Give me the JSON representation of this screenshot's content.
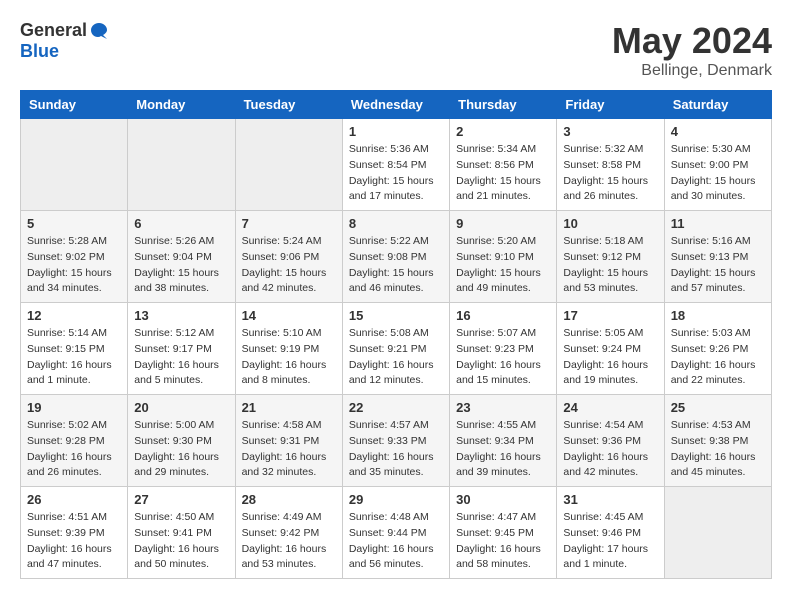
{
  "header": {
    "logo_general": "General",
    "logo_blue": "Blue",
    "title": "May 2024",
    "subtitle": "Bellinge, Denmark"
  },
  "weekdays": [
    "Sunday",
    "Monday",
    "Tuesday",
    "Wednesday",
    "Thursday",
    "Friday",
    "Saturday"
  ],
  "weeks": [
    [
      {
        "day": "",
        "info": ""
      },
      {
        "day": "",
        "info": ""
      },
      {
        "day": "",
        "info": ""
      },
      {
        "day": "1",
        "info": "Sunrise: 5:36 AM\nSunset: 8:54 PM\nDaylight: 15 hours\nand 17 minutes."
      },
      {
        "day": "2",
        "info": "Sunrise: 5:34 AM\nSunset: 8:56 PM\nDaylight: 15 hours\nand 21 minutes."
      },
      {
        "day": "3",
        "info": "Sunrise: 5:32 AM\nSunset: 8:58 PM\nDaylight: 15 hours\nand 26 minutes."
      },
      {
        "day": "4",
        "info": "Sunrise: 5:30 AM\nSunset: 9:00 PM\nDaylight: 15 hours\nand 30 minutes."
      }
    ],
    [
      {
        "day": "5",
        "info": "Sunrise: 5:28 AM\nSunset: 9:02 PM\nDaylight: 15 hours\nand 34 minutes."
      },
      {
        "day": "6",
        "info": "Sunrise: 5:26 AM\nSunset: 9:04 PM\nDaylight: 15 hours\nand 38 minutes."
      },
      {
        "day": "7",
        "info": "Sunrise: 5:24 AM\nSunset: 9:06 PM\nDaylight: 15 hours\nand 42 minutes."
      },
      {
        "day": "8",
        "info": "Sunrise: 5:22 AM\nSunset: 9:08 PM\nDaylight: 15 hours\nand 46 minutes."
      },
      {
        "day": "9",
        "info": "Sunrise: 5:20 AM\nSunset: 9:10 PM\nDaylight: 15 hours\nand 49 minutes."
      },
      {
        "day": "10",
        "info": "Sunrise: 5:18 AM\nSunset: 9:12 PM\nDaylight: 15 hours\nand 53 minutes."
      },
      {
        "day": "11",
        "info": "Sunrise: 5:16 AM\nSunset: 9:13 PM\nDaylight: 15 hours\nand 57 minutes."
      }
    ],
    [
      {
        "day": "12",
        "info": "Sunrise: 5:14 AM\nSunset: 9:15 PM\nDaylight: 16 hours\nand 1 minute."
      },
      {
        "day": "13",
        "info": "Sunrise: 5:12 AM\nSunset: 9:17 PM\nDaylight: 16 hours\nand 5 minutes."
      },
      {
        "day": "14",
        "info": "Sunrise: 5:10 AM\nSunset: 9:19 PM\nDaylight: 16 hours\nand 8 minutes."
      },
      {
        "day": "15",
        "info": "Sunrise: 5:08 AM\nSunset: 9:21 PM\nDaylight: 16 hours\nand 12 minutes."
      },
      {
        "day": "16",
        "info": "Sunrise: 5:07 AM\nSunset: 9:23 PM\nDaylight: 16 hours\nand 15 minutes."
      },
      {
        "day": "17",
        "info": "Sunrise: 5:05 AM\nSunset: 9:24 PM\nDaylight: 16 hours\nand 19 minutes."
      },
      {
        "day": "18",
        "info": "Sunrise: 5:03 AM\nSunset: 9:26 PM\nDaylight: 16 hours\nand 22 minutes."
      }
    ],
    [
      {
        "day": "19",
        "info": "Sunrise: 5:02 AM\nSunset: 9:28 PM\nDaylight: 16 hours\nand 26 minutes."
      },
      {
        "day": "20",
        "info": "Sunrise: 5:00 AM\nSunset: 9:30 PM\nDaylight: 16 hours\nand 29 minutes."
      },
      {
        "day": "21",
        "info": "Sunrise: 4:58 AM\nSunset: 9:31 PM\nDaylight: 16 hours\nand 32 minutes."
      },
      {
        "day": "22",
        "info": "Sunrise: 4:57 AM\nSunset: 9:33 PM\nDaylight: 16 hours\nand 35 minutes."
      },
      {
        "day": "23",
        "info": "Sunrise: 4:55 AM\nSunset: 9:34 PM\nDaylight: 16 hours\nand 39 minutes."
      },
      {
        "day": "24",
        "info": "Sunrise: 4:54 AM\nSunset: 9:36 PM\nDaylight: 16 hours\nand 42 minutes."
      },
      {
        "day": "25",
        "info": "Sunrise: 4:53 AM\nSunset: 9:38 PM\nDaylight: 16 hours\nand 45 minutes."
      }
    ],
    [
      {
        "day": "26",
        "info": "Sunrise: 4:51 AM\nSunset: 9:39 PM\nDaylight: 16 hours\nand 47 minutes."
      },
      {
        "day": "27",
        "info": "Sunrise: 4:50 AM\nSunset: 9:41 PM\nDaylight: 16 hours\nand 50 minutes."
      },
      {
        "day": "28",
        "info": "Sunrise: 4:49 AM\nSunset: 9:42 PM\nDaylight: 16 hours\nand 53 minutes."
      },
      {
        "day": "29",
        "info": "Sunrise: 4:48 AM\nSunset: 9:44 PM\nDaylight: 16 hours\nand 56 minutes."
      },
      {
        "day": "30",
        "info": "Sunrise: 4:47 AM\nSunset: 9:45 PM\nDaylight: 16 hours\nand 58 minutes."
      },
      {
        "day": "31",
        "info": "Sunrise: 4:45 AM\nSunset: 9:46 PM\nDaylight: 17 hours\nand 1 minute."
      },
      {
        "day": "",
        "info": ""
      }
    ]
  ]
}
